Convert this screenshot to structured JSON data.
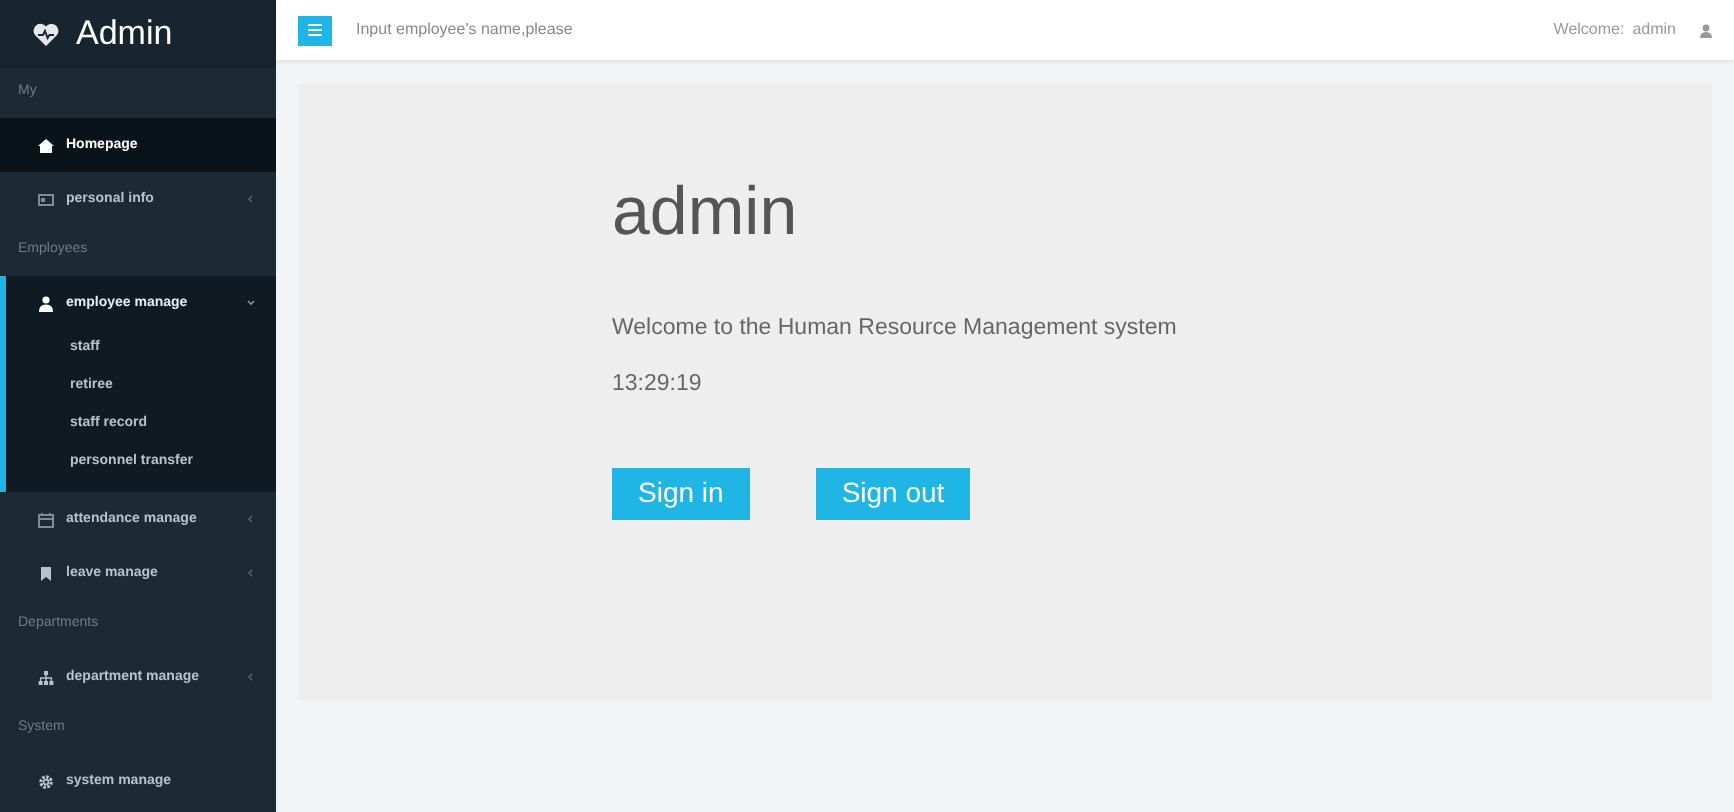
{
  "brand": {
    "title": "Admin"
  },
  "header": {
    "search": {
      "placeholder": "Input employee's name,please"
    },
    "welcome": "Welcome:",
    "user": "admin"
  },
  "sidebar": {
    "sections": [
      {
        "heading": "My",
        "items": [
          {
            "label": "Homepage",
            "selected": true
          },
          {
            "label": "personal info",
            "selected": false,
            "expanded": false
          }
        ]
      },
      {
        "heading": "Employees",
        "items": [
          {
            "label": "employee manage",
            "selected": false,
            "expanded": true,
            "children": [
              {
                "label": "staff",
                "selected": false
              },
              {
                "label": "retiree",
                "selected": false
              },
              {
                "label": "staff record",
                "selected": false
              },
              {
                "label": "personnel transfer",
                "selected": false
              }
            ]
          },
          {
            "label": "attendance manage",
            "selected": false,
            "expanded": false
          },
          {
            "label": "leave manage",
            "selected": false,
            "expanded": false
          }
        ]
      },
      {
        "heading": "Departments",
        "items": [
          {
            "label": "department manage",
            "selected": false,
            "expanded": false
          }
        ]
      },
      {
        "heading": "System",
        "items": [
          {
            "label": "system manage",
            "selected": false
          }
        ]
      }
    ]
  },
  "panel": {
    "title": "admin",
    "message": "Welcome to the Human Resource Management system",
    "time": "13:29:19",
    "buttons": [
      "Sign in",
      "Sign out"
    ]
  }
}
